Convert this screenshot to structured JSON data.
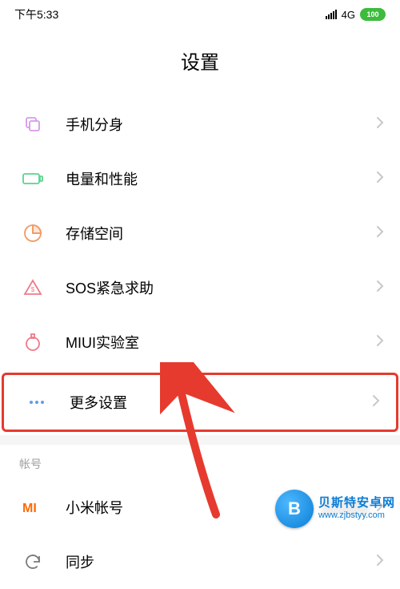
{
  "status": {
    "time": "下午5:33",
    "network": "4G",
    "battery": "100"
  },
  "title": "设置",
  "items": [
    {
      "key": "second-space",
      "label": "手机分身"
    },
    {
      "key": "battery-perf",
      "label": "电量和性能"
    },
    {
      "key": "storage",
      "label": "存储空间"
    },
    {
      "key": "sos",
      "label": "SOS紧急求助"
    },
    {
      "key": "miui-lab",
      "label": "MIUI实验室"
    },
    {
      "key": "more-settings",
      "label": "更多设置",
      "highlighted": true
    }
  ],
  "account_section": {
    "header": "帐号",
    "items": [
      {
        "key": "mi-account",
        "label": "小米帐号"
      },
      {
        "key": "sync",
        "label": "同步"
      }
    ]
  },
  "watermark": {
    "name": "贝斯特安卓网",
    "url": "www.zjbstyy.com"
  },
  "colors": {
    "highlight": "#e63a2e",
    "arrow": "#e63a2e",
    "battery_pill": "#3dbb3d"
  }
}
